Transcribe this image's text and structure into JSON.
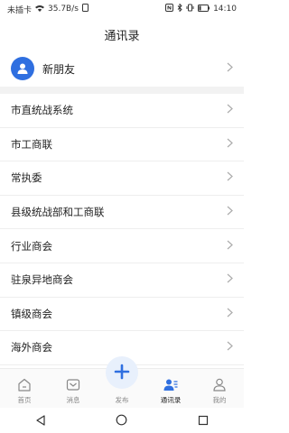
{
  "status_bar": {
    "carrier": "未插卡",
    "speed": "35.7B/s",
    "battery_pct": "14",
    "time": "14:10"
  },
  "header": {
    "title": "通讯录"
  },
  "new_friend": {
    "label": "新朋友",
    "icon": "user-icon"
  },
  "list": [
    {
      "label": "市直统战系统"
    },
    {
      "label": "市工商联"
    },
    {
      "label": "常执委"
    },
    {
      "label": "县级统战部和工商联"
    },
    {
      "label": "行业商会"
    },
    {
      "label": "驻泉异地商会"
    },
    {
      "label": "镇级商会"
    },
    {
      "label": "海外商会"
    }
  ],
  "tabbar": {
    "tabs": [
      {
        "label": "首页",
        "icon": "home-icon"
      },
      {
        "label": "消息",
        "icon": "message-icon"
      },
      {
        "label": "发布",
        "icon": "plus-icon"
      },
      {
        "label": "通讯录",
        "icon": "contacts-icon",
        "active": true
      },
      {
        "label": "我的",
        "icon": "profile-icon"
      }
    ]
  },
  "colors": {
    "accent": "#2f6fe0",
    "divider": "#f2f2f2"
  }
}
